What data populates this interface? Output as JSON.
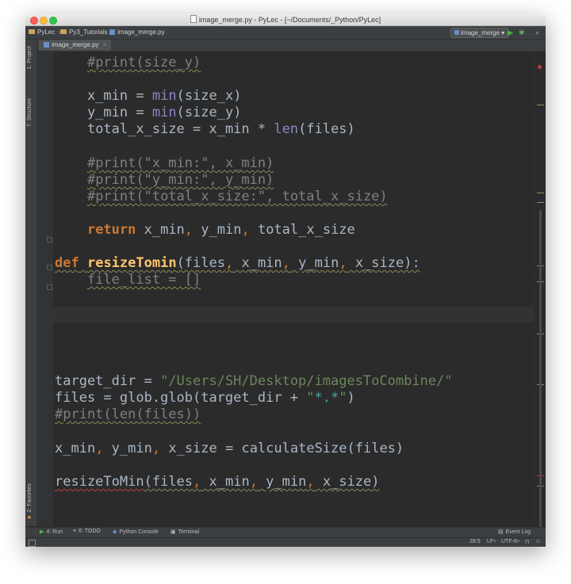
{
  "window": {
    "title": "image_merge.py - PyLec - [~/Documents/_Python/PyLec]"
  },
  "navbar": {
    "crumbs": [
      "PyLec",
      "Py3_Tutorials",
      "image_merge.py"
    ],
    "run_config": "image_merge"
  },
  "left_tools": {
    "project": "1: Project",
    "structure": "7: Structure",
    "favorites": "2: Favorites"
  },
  "tab": {
    "label": "image_merge.py"
  },
  "code": {
    "l1": "#print(size_y)",
    "l2_a": "x_min",
    "l2_b": " = ",
    "l2_c": "min",
    "l2_d": "(size_x)",
    "l3_a": "y_min",
    "l3_b": " = ",
    "l3_c": "min",
    "l3_d": "(size_y)",
    "l4_a": "total_x_size = x_min * ",
    "l4_b": "len",
    "l4_c": "(files)",
    "l5": "#print(\"x_min:\", x_min)",
    "l6": "#print(\"y_min:\", y_min)",
    "l7": "#print(\"total_x_size:\", total_x_size)",
    "l8_kw": "return",
    "l8_a": " x_min",
    "l8_c1": ",",
    "l8_b": " y_min",
    "l8_c2": ",",
    "l8_c": " total_x_size",
    "l9_kw": "def",
    "l9_fn": "resizeTomin",
    "l9_a": "(files",
    "l9_c1": ",",
    "l9_b": " x_min",
    "l9_c2": ",",
    "l9_c": " y_min",
    "l9_c3": ",",
    "l9_d": " x_size):",
    "l10": "file_list = []",
    "l11_a": "target_dir = ",
    "l11_s": "\"/Users/SH/Desktop/imagesToCombine/\"",
    "l12_a": "files = glob.glob(target_dir + ",
    "l12_s1": "\"",
    "l12_s2": "*.*",
    "l12_s3": "\"",
    "l12_b": ")",
    "l13": "#print(len(files))",
    "l14_a": "x_min",
    "l14_c1": ",",
    "l14_b": " y_min",
    "l14_c2": ",",
    "l14_c": " x_size = calculateSize(files)",
    "l15_fn": "resizeToMin",
    "l15_a": "(files",
    "l15_c1": ",",
    "l15_b": " x_min",
    "l15_c2": ",",
    "l15_c": " y_min",
    "l15_c3": ",",
    "l15_d": " x_size)"
  },
  "bottom_tools": {
    "run": "4: Run",
    "todo": "6: TODO",
    "console": "Python Console",
    "terminal": "Terminal",
    "event_log": "Event Log"
  },
  "status": {
    "position": "28:5",
    "line_sep": "LF÷",
    "encoding": "UTF-8÷"
  },
  "colors": {
    "keyword": "#cc7832",
    "builtin": "#8888c6",
    "function": "#ffc66d",
    "comment": "#808080",
    "string": "#6a8759",
    "background": "#2b2b2b"
  }
}
